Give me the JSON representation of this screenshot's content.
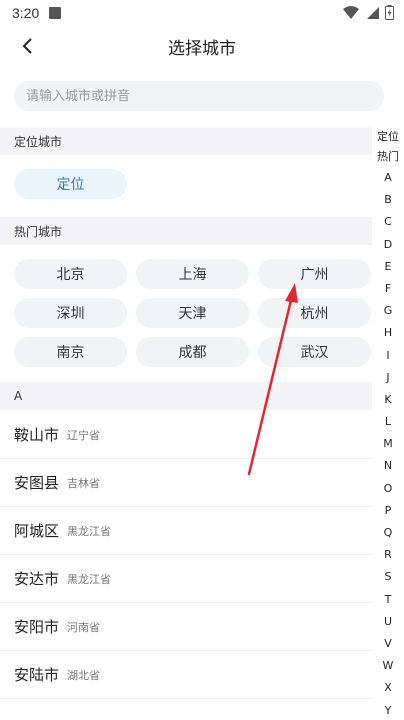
{
  "status_bar": {
    "time": "3:20"
  },
  "header": {
    "title": "选择城市"
  },
  "search": {
    "placeholder": "请输入城市或拼音"
  },
  "locate_section": {
    "header": "定位城市",
    "button": "定位"
  },
  "hot_section": {
    "header": "热门城市",
    "cities": [
      "北京",
      "上海",
      "广州",
      "深圳",
      "天津",
      "杭州",
      "南京",
      "成都",
      "武汉"
    ]
  },
  "list_section": {
    "header": "A",
    "cities": [
      {
        "name": "鞍山市",
        "province": "辽宁省"
      },
      {
        "name": "安图县",
        "province": "吉林省"
      },
      {
        "name": "阿城区",
        "province": "黑龙江省"
      },
      {
        "name": "安达市",
        "province": "黑龙江省"
      },
      {
        "name": "安阳市",
        "province": "河南省"
      },
      {
        "name": "安陆市",
        "province": "湖北省"
      }
    ]
  },
  "index_bar": [
    "定位",
    "热门",
    "A",
    "B",
    "C",
    "D",
    "E",
    "F",
    "G",
    "H",
    "I",
    "J",
    "K",
    "L",
    "M",
    "N",
    "O",
    "P",
    "Q",
    "R",
    "S",
    "T",
    "U",
    "V",
    "W",
    "X",
    "Y"
  ],
  "colors": {
    "annotation_arrow": "#e0282e",
    "accent": "#3a78c3"
  }
}
